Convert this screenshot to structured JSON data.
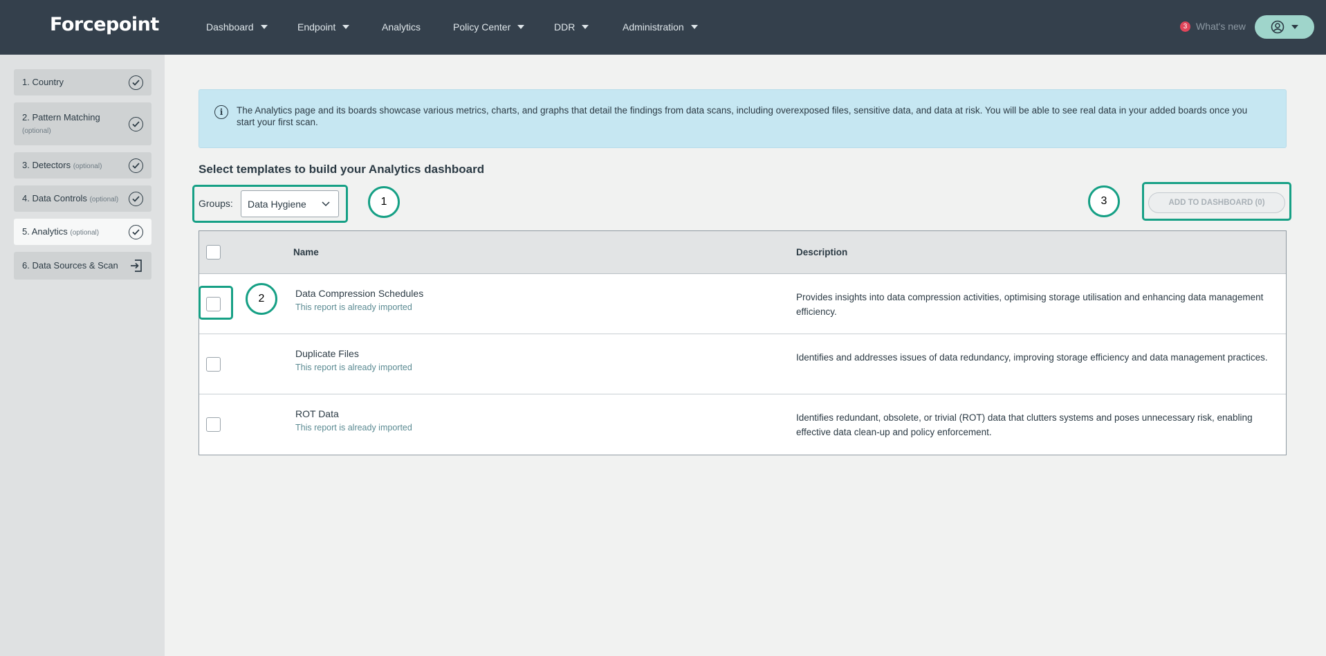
{
  "header": {
    "logo": "Forcepoint",
    "nav": [
      {
        "label": "Dashboard",
        "dropdown": true
      },
      {
        "label": "Endpoint",
        "dropdown": true
      },
      {
        "label": "Analytics",
        "dropdown": false
      },
      {
        "label": "Policy Center",
        "dropdown": true
      },
      {
        "label": "DDR",
        "dropdown": true
      },
      {
        "label": "Administration",
        "dropdown": true
      }
    ],
    "whats_new_count": "3",
    "whats_new_label": "What's new"
  },
  "sidebar": {
    "steps": [
      {
        "label": "1. Country",
        "optional": "",
        "icon": "check-circle-icon",
        "active": false
      },
      {
        "label": "2. Pattern Matching",
        "optional": "(optional)",
        "icon": "check-circle-icon",
        "active": false
      },
      {
        "label": "3. Detectors",
        "optional": "(optional)",
        "icon": "check-circle-icon",
        "active": false
      },
      {
        "label": "4. Data Controls",
        "optional": "(optional)",
        "icon": "check-circle-icon",
        "active": false
      },
      {
        "label": "5. Analytics",
        "optional": "(optional)",
        "icon": "check-circle-icon",
        "active": true
      },
      {
        "label": "6. Data Sources & Scan",
        "optional": "",
        "icon": "enter-icon",
        "active": false
      }
    ]
  },
  "main": {
    "info_text": "The Analytics page and its boards showcase various metrics, charts, and graphs that detail the findings from data scans, including overexposed files, sensitive data, and data at risk. You will be able to see real data in your added boards once you start your first scan.",
    "section_title": "Select templates to build your Analytics dashboard",
    "groups_label": "Groups:",
    "groups_value": "Data Hygiene",
    "add_button": "ADD TO DASHBOARD (0)",
    "callouts": [
      "1",
      "2",
      "3"
    ],
    "table": {
      "columns": [
        "Name",
        "Description"
      ],
      "rows": [
        {
          "name": "Data Compression Schedules",
          "sub": "This report is already imported",
          "desc": "Provides insights into data compression activities, optimising storage utilisation and enhancing data management efficiency."
        },
        {
          "name": "Duplicate Files",
          "sub": "This report is already imported",
          "desc": "Identifies and addresses issues of data redundancy, improving storage efficiency and data management practices."
        },
        {
          "name": "ROT Data",
          "sub": "This report is already imported",
          "desc": "Identifies redundant, obsolete, or trivial (ROT) data that clutters systems and poses unnecessary risk, enabling effective data clean-up and policy enforcement."
        }
      ]
    }
  },
  "colors": {
    "topbar": "#34404c",
    "accent": "#16a085",
    "info_bg": "#c6e7f2",
    "badge": "#e0455a"
  }
}
